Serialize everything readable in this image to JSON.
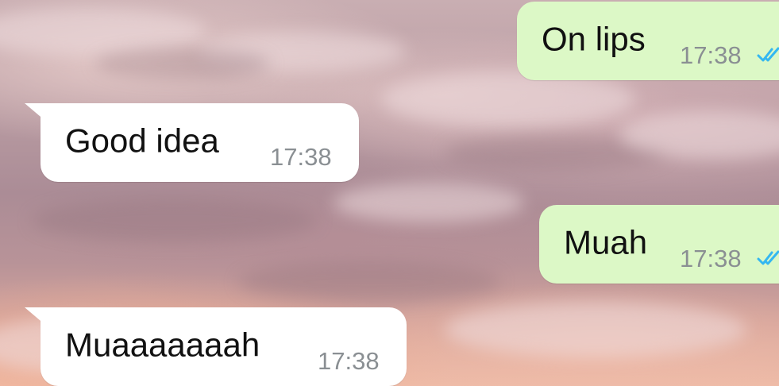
{
  "chat": {
    "messages": [
      {
        "direction": "outgoing",
        "text": "On lips",
        "time": "17:38",
        "status_icon": "delivered-double-check-icon"
      },
      {
        "direction": "incoming",
        "text": "Good idea",
        "time": "17:38"
      },
      {
        "direction": "outgoing",
        "text": "Muah",
        "time": "17:38",
        "status_icon": "delivered-double-check-icon"
      },
      {
        "direction": "incoming",
        "text": "Muaaaaaaah",
        "time": "17:38"
      }
    ]
  },
  "colors": {
    "incoming_bubble": "#ffffff",
    "outgoing_bubble": "#dcf8c6",
    "timestamp": "#8a8f93",
    "tick": "#34b7f1"
  }
}
